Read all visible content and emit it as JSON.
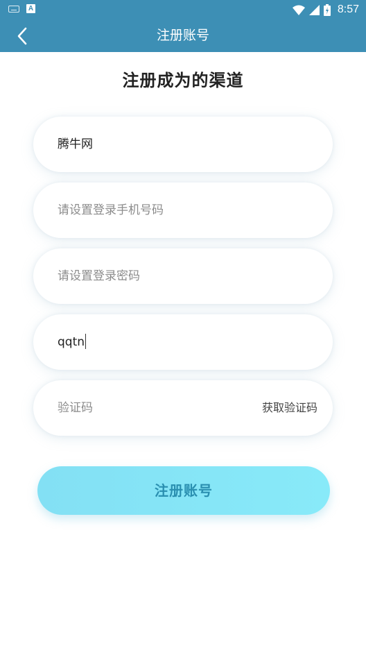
{
  "status_bar": {
    "time": "8:57",
    "icons": [
      "keyboard-icon",
      "a-notification-icon",
      "wifi-icon",
      "signal-icon",
      "battery-icon"
    ]
  },
  "header": {
    "title": "注册账号",
    "back_icon": "chevron-left-icon"
  },
  "form": {
    "heading": "注册成为的渠道",
    "channel_value": "腾牛网",
    "phone_placeholder": "请设置登录手机号码",
    "password_placeholder": "请设置登录密码",
    "invite_value": "qqtn",
    "code_placeholder": "验证码",
    "get_code_label": "获取验证码",
    "submit_label": "注册账号"
  },
  "colors": {
    "header_bg": "#3d8fb5",
    "button_bg": "#85e4f6",
    "button_text": "#2a8fb0"
  }
}
